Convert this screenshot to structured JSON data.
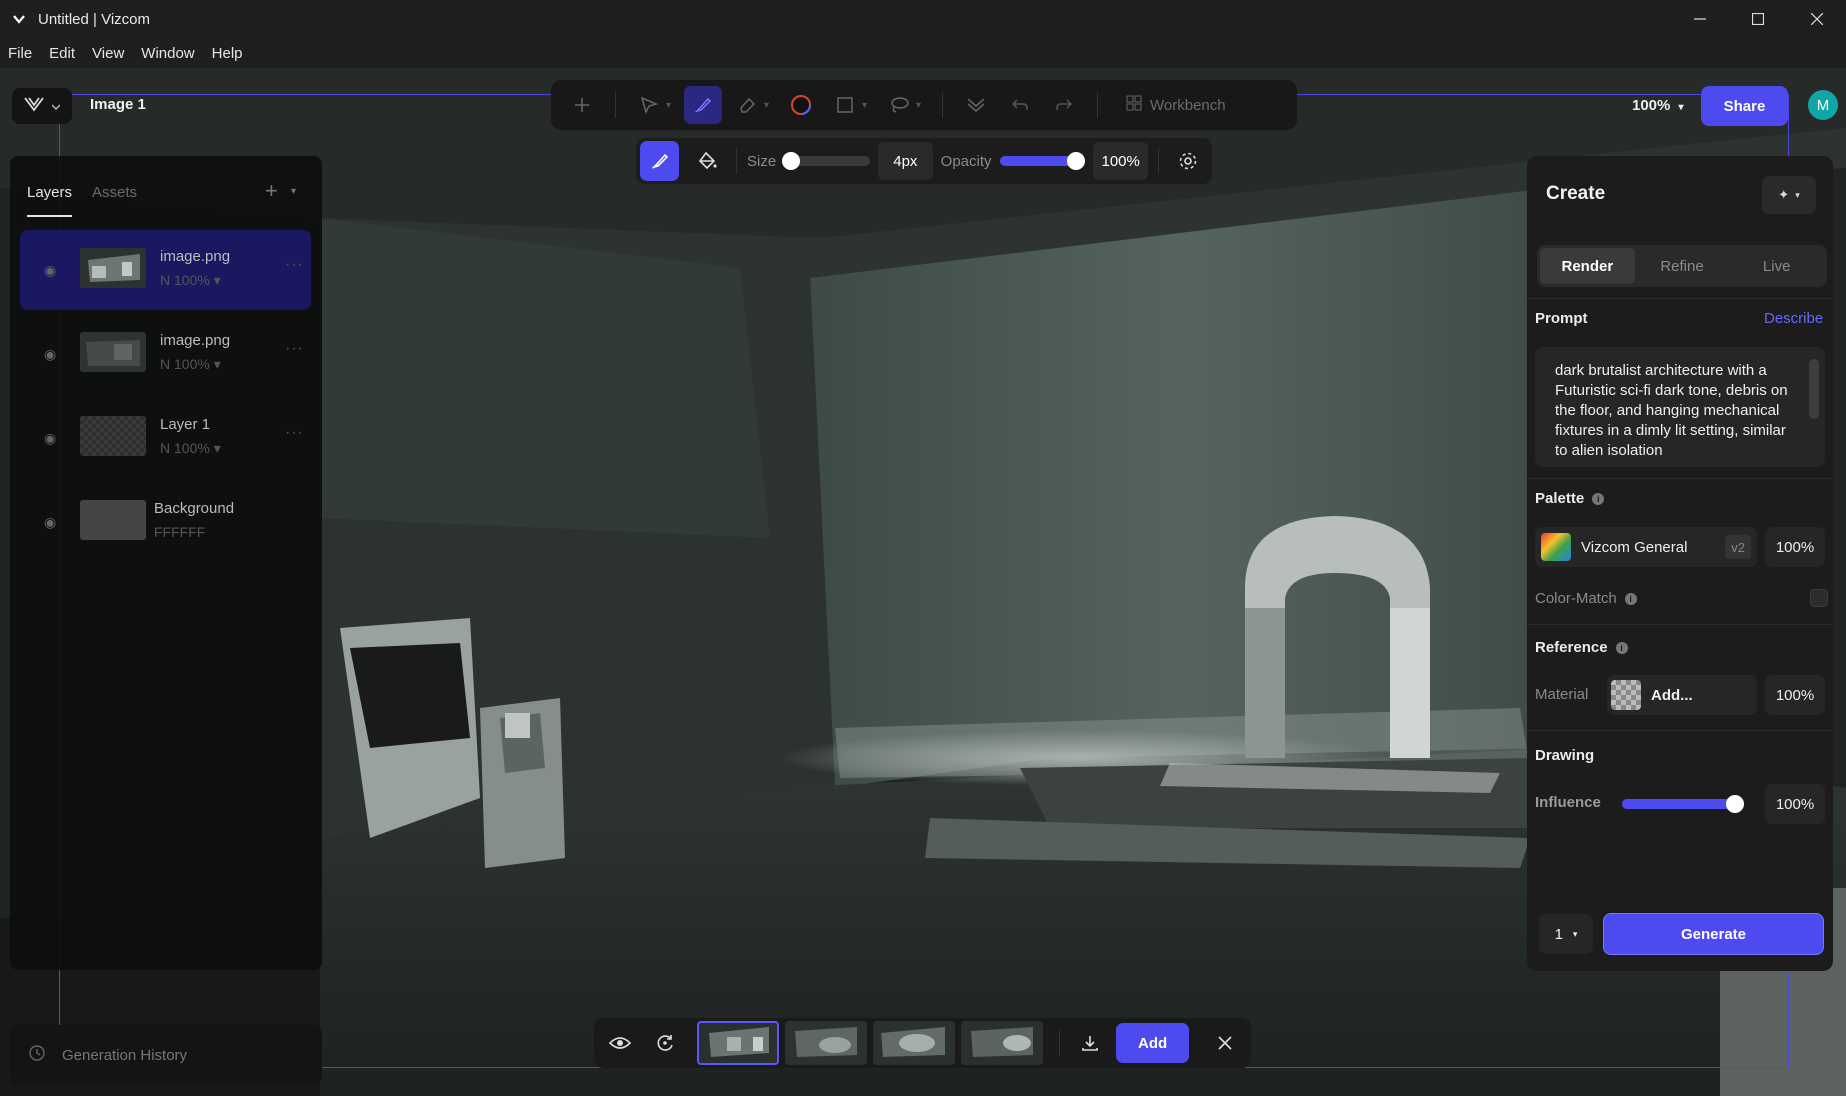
{
  "window": {
    "title": "Untitled | Vizcom",
    "controls": [
      "minimize-icon",
      "maximize-icon",
      "close-icon"
    ]
  },
  "menu": [
    "File",
    "Edit",
    "View",
    "Window",
    "Help"
  ],
  "header": {
    "document_name": "Image 1",
    "zoom": "100%",
    "share_label": "Share",
    "avatar_initial": "M"
  },
  "toolbar": {
    "workbench_label": "Workbench",
    "icons": [
      "plus-icon",
      "select-arrow-icon",
      "brush-icon",
      "eraser-icon",
      "color-circle-icon",
      "rectangle-icon",
      "lasso-icon",
      "layers-down-icon",
      "undo-icon",
      "redo-icon",
      "workbench-icon"
    ],
    "active_tool": "brush"
  },
  "brush": {
    "size_label": "Size",
    "size_value": "4px",
    "size_fraction": 0.08,
    "opacity_label": "Opacity",
    "opacity_value": "100%",
    "opacity_fraction": 1.0
  },
  "layers_panel": {
    "tabs": [
      "Layers",
      "Assets"
    ],
    "active_tab": "Layers",
    "layers": [
      {
        "name": "image.png",
        "meta": "N 100%",
        "selected": true
      },
      {
        "name": "image.png",
        "meta": "N 100%",
        "selected": false
      },
      {
        "name": "Layer 1",
        "meta": "N 100%",
        "selected": false
      },
      {
        "name": "Background",
        "meta": "FFFFFF",
        "selected": false
      }
    ]
  },
  "generation_history_label": "Generation History",
  "create_panel": {
    "title": "Create",
    "modes": [
      "Render",
      "Refine",
      "Live"
    ],
    "active_mode": "Render",
    "prompt_label": "Prompt",
    "describe_label": "Describe",
    "prompt_text": "dark brutalist architecture with a Futuristic sci-fi dark tone, debris on the floor, and hanging mechanical fixtures in a dimly lit setting, similar to alien isolation",
    "palette_label": "Palette",
    "palette_name": "Vizcom General",
    "palette_version": "v2",
    "palette_strength": "100%",
    "color_match_label": "Color-Match",
    "reference_label": "Reference",
    "material_label": "Material",
    "material_add": "Add...",
    "material_strength": "100%",
    "drawing_label": "Drawing",
    "influence_label": "Influence",
    "influence_value": "100%",
    "influence_fraction": 1.0,
    "output_count": "1",
    "generate_label": "Generate"
  },
  "bottom_bar": {
    "add_label": "Add",
    "thumbnail_count": 4,
    "active_thumbnail": 0
  },
  "colors": {
    "accent": "#4d4af0",
    "panel": "#1c1c1c",
    "avatar": "#11a6a6",
    "describe_link": "#6a67ff"
  }
}
